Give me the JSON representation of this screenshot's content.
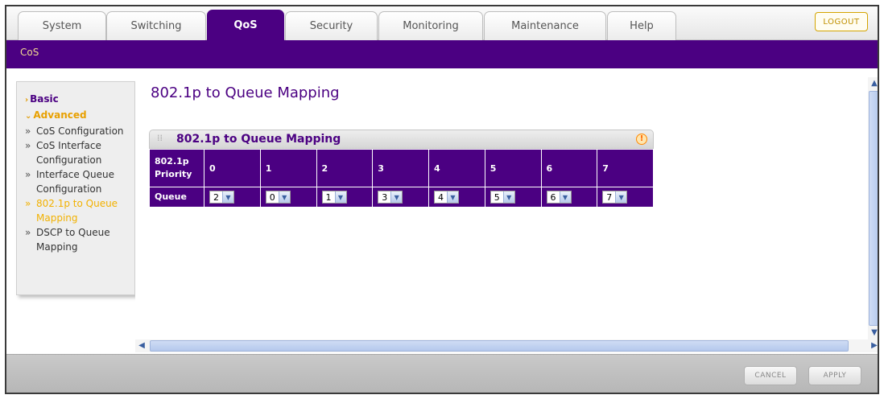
{
  "tabs": [
    {
      "label": "System",
      "active": false
    },
    {
      "label": "Switching",
      "active": false
    },
    {
      "label": "QoS",
      "active": true
    },
    {
      "label": "Security",
      "active": false
    },
    {
      "label": "Monitoring",
      "active": false
    },
    {
      "label": "Maintenance",
      "active": false
    },
    {
      "label": "Help",
      "active": false
    }
  ],
  "logout_label": "LOGOUT",
  "subnav": {
    "active": "CoS"
  },
  "sidebar": {
    "basic": "Basic",
    "advanced": "Advanced",
    "items": [
      {
        "label": "CoS Configuration",
        "current": false
      },
      {
        "label": "CoS Interface Configuration",
        "current": false
      },
      {
        "label": "Interface Queue Configuration",
        "current": false
      },
      {
        "label": "802.1p to Queue Mapping",
        "current": true
      },
      {
        "label": "DSCP to Queue Mapping",
        "current": false
      }
    ]
  },
  "page_title": "802.1p to Queue Mapping",
  "panel": {
    "title": "802.1p to Queue Mapping",
    "help_symbol": "!",
    "row_priority_label": "802.1p Priority",
    "row_queue_label": "Queue",
    "priorities": [
      "0",
      "1",
      "2",
      "3",
      "4",
      "5",
      "6",
      "7"
    ],
    "queues": [
      "2",
      "0",
      "1",
      "3",
      "4",
      "5",
      "6",
      "7"
    ]
  },
  "buttons": {
    "cancel": "CANCEL",
    "apply": "APPLY"
  },
  "colors": {
    "primary_purple": "#4b0082",
    "accent_orange": "#e8a000"
  }
}
